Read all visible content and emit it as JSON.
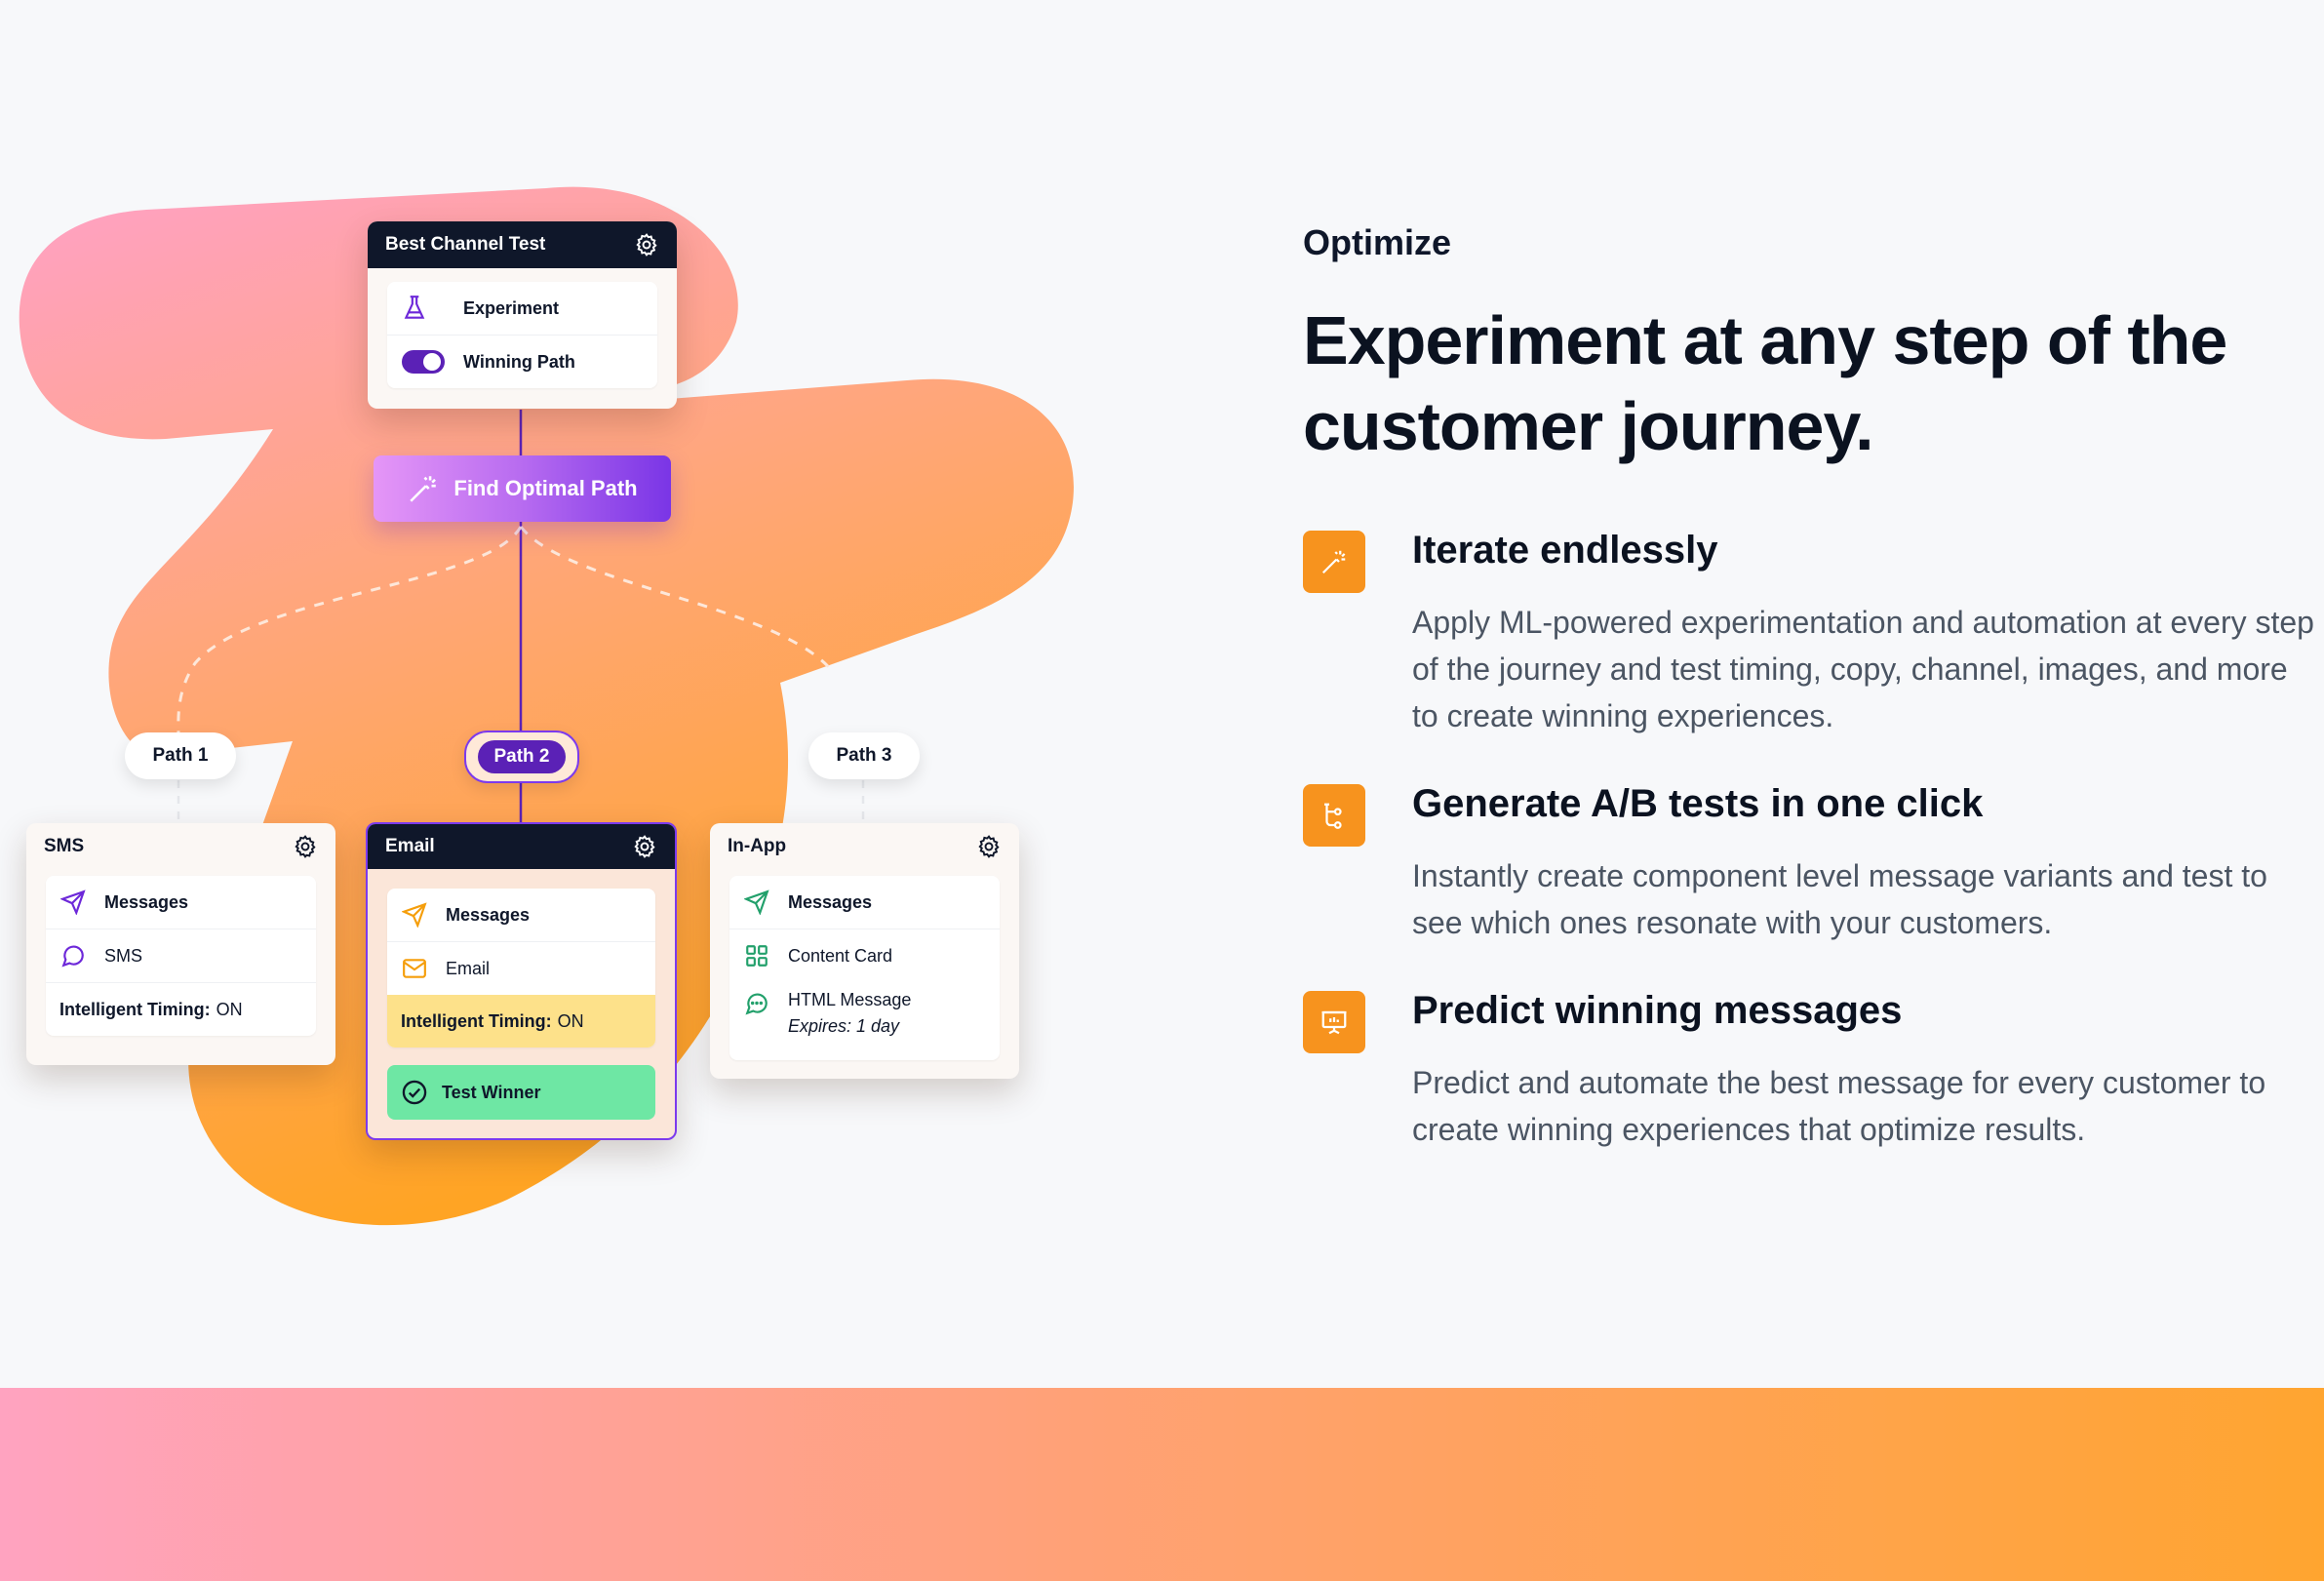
{
  "illustration": {
    "top_card": {
      "title": "Best Channel Test",
      "rows": [
        "Experiment",
        "Winning Path"
      ],
      "icons": [
        "flask-icon",
        "toggle-icon",
        "gear-icon"
      ]
    },
    "find_button": {
      "label": "Find Optimal Path",
      "icon": "magic-wand-icon"
    },
    "paths": [
      "Path 1",
      "Path 2",
      "Path 3"
    ],
    "sms_card": {
      "title": "SMS",
      "rows": [
        "Messages",
        "SMS"
      ],
      "timing_label": "Intelligent Timing:",
      "timing_value": "ON"
    },
    "email_card": {
      "title": "Email",
      "rows": [
        "Messages",
        "Email"
      ],
      "timing_label": "Intelligent Timing:",
      "timing_value": "ON",
      "winner": "Test Winner"
    },
    "inapp_card": {
      "title": "In-App",
      "rows": [
        "Messages",
        "Content Card",
        "HTML Message"
      ],
      "expires": "Expires: 1 day"
    },
    "colors": {
      "dark": "#0f172a",
      "purple": "#5b21b6",
      "green": "#6ee7a4",
      "orange": "#f7931e",
      "pink": "#ffa3c0"
    }
  },
  "content": {
    "eyebrow": "Optimize",
    "headline": "Experiment at any step of the customer journey.",
    "features": [
      {
        "icon": "magic-wand-icon",
        "title": "Iterate endlessly",
        "desc": "Apply ML-powered experimentation and automation at every step of the journey and test timing, copy, channel, images, and more to create winning experiences."
      },
      {
        "icon": "branch-icon",
        "title": "Generate A/B tests in one click",
        "desc": "Instantly create component level message variants and test to see which ones resonate with your customers."
      },
      {
        "icon": "presentation-icon",
        "title": "Predict winning messages",
        "desc": "Predict and automate the best message for every customer to create winning experiences that optimize results."
      }
    ]
  }
}
